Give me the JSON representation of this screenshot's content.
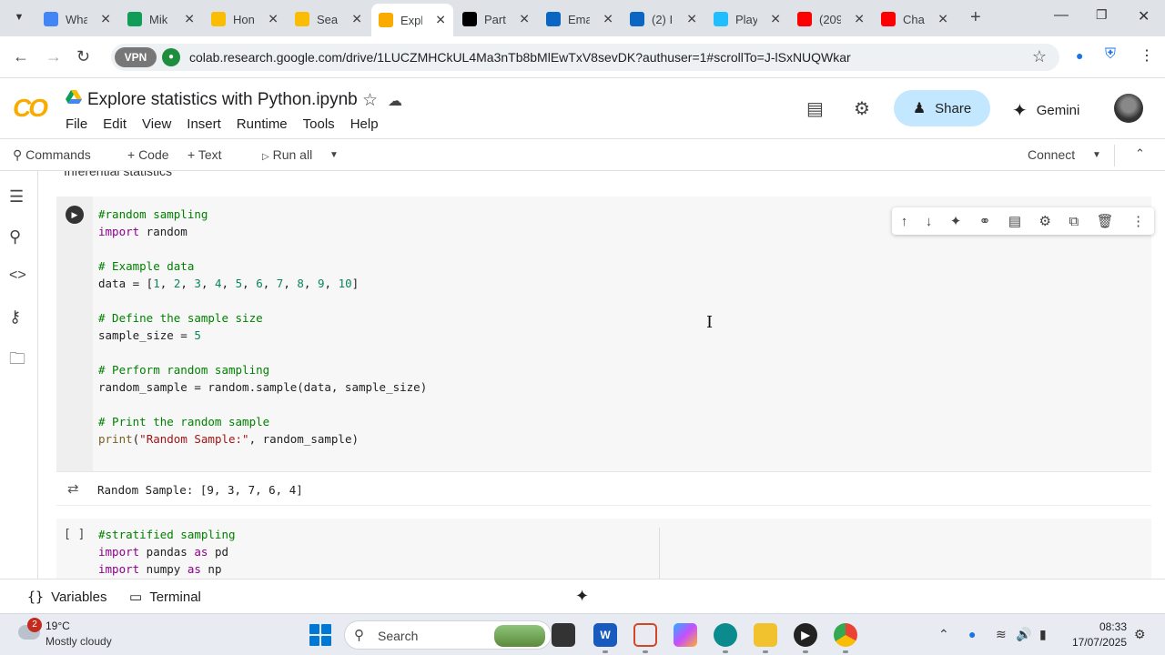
{
  "browser": {
    "tabs": [
      {
        "title": "Wha",
        "icon": "google-icon",
        "color": "#4285f4"
      },
      {
        "title": "Mik",
        "icon": "sheets-icon",
        "color": "#0f9d58"
      },
      {
        "title": "Hon",
        "icon": "drive-icon",
        "color": "#fbbc04"
      },
      {
        "title": "Sear",
        "icon": "drive-icon",
        "color": "#fbbc04"
      },
      {
        "title": "Expl",
        "icon": "colab-icon",
        "color": "#f9ab00"
      },
      {
        "title": "Part",
        "icon": "medium-icon",
        "color": "#000000"
      },
      {
        "title": "Ema",
        "icon": "outlook-icon",
        "color": "#0a66c2"
      },
      {
        "title": "(2) I",
        "icon": "linkedin-icon",
        "color": "#0a66c2"
      },
      {
        "title": "Play",
        "icon": "kaggle-icon",
        "color": "#20beff"
      },
      {
        "title": "(209",
        "icon": "youtube-icon",
        "color": "#ff0000"
      },
      {
        "title": "Cha",
        "icon": "youtube-icon",
        "color": "#ff0000"
      }
    ],
    "vpn_label": "VPN",
    "url": "colab.research.google.com/drive/1LUCZMHCkUL4Ma3nTb8bMlEwTxV8sevDK?authuser=1#scrollTo=J-lSxNUQWkar"
  },
  "colab": {
    "notebook_title": "Explore statistics with Python.ipynb",
    "menu": [
      "File",
      "Edit",
      "View",
      "Insert",
      "Runtime",
      "Tools",
      "Help"
    ],
    "share_label": "Share",
    "gemini_label": "Gemini",
    "toolbar": {
      "commands": "Commands",
      "code": "+ Code",
      "text": "+ Text",
      "run_all": "Run all",
      "connect": "Connect"
    },
    "section_peek": "Inferential statistics"
  },
  "cell1": {
    "lines": [
      {
        "kind": "cm",
        "text": "#random sampling"
      },
      {
        "kind": "import",
        "kw": "import",
        "rest": " random"
      },
      {
        "kind": "blank",
        "text": ""
      },
      {
        "kind": "cm",
        "text": "# Example data"
      },
      {
        "kind": "data",
        "text": "data = [1, 2, 3, 4, 5, 6, 7, 8, 9, 10]"
      },
      {
        "kind": "blank",
        "text": ""
      },
      {
        "kind": "cm",
        "text": "# Define the sample size"
      },
      {
        "kind": "size",
        "text": "sample_size = 5"
      },
      {
        "kind": "blank",
        "text": ""
      },
      {
        "kind": "cm",
        "text": "# Perform random sampling"
      },
      {
        "kind": "plain",
        "text": "random_sample = random.sample(data, sample_size)"
      },
      {
        "kind": "blank",
        "text": ""
      },
      {
        "kind": "cm",
        "text": "# Print the random sample"
      },
      {
        "kind": "print",
        "text": "print(\"Random Sample:\", random_sample)"
      }
    ],
    "output": "Random Sample: [9, 3, 7, 6, 4]"
  },
  "cell2": {
    "gutter": "[ ]",
    "lines": [
      {
        "kind": "cm",
        "text": "#stratified sampling"
      },
      {
        "kind": "import_as",
        "kw": "import",
        "mod": " pandas ",
        "as": "as",
        "alias": " pd"
      },
      {
        "kind": "import_as",
        "kw": "import",
        "mod": " numpy ",
        "as": "as",
        "alias": " np"
      }
    ]
  },
  "bottom_bar": {
    "variables": "Variables",
    "terminal": "Terminal"
  },
  "taskbar": {
    "weather_badge": "2",
    "temperature": "19°C",
    "condition": "Mostly cloudy",
    "search": "Search",
    "time": "08:33",
    "date": "17/07/2025"
  }
}
